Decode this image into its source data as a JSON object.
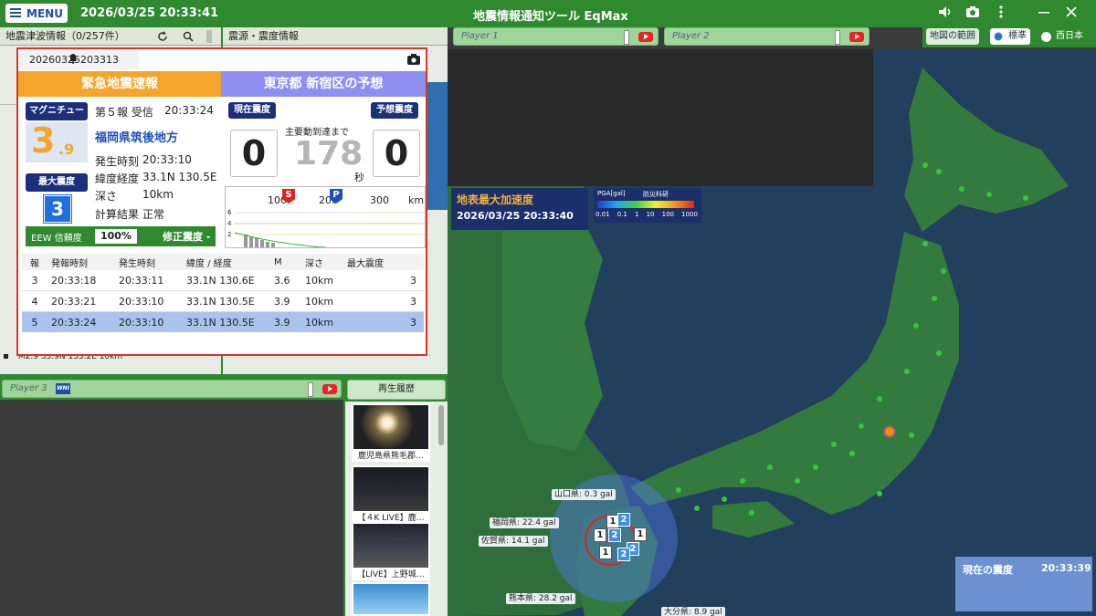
{
  "topbar": {
    "menu_label": "MENU",
    "datetime": "2026/03/25 20:33:41",
    "title": "地震情報通知ツール EqMax"
  },
  "quake_list": {
    "title": "地震津波情報（0/257件）",
    "last_item": "M2.9  33.9N 135.2E  10km"
  },
  "source_panel": {
    "title": "震源・震度情報"
  },
  "players": {
    "p1": "Player 1",
    "p2": "Player 2",
    "p3": "Player 3"
  },
  "map_controls": {
    "range_label": "地図の範囲",
    "option_standard": "標準",
    "option_west": "西日本"
  },
  "eew": {
    "id": "20260325203313",
    "left_title": "緊急地震速報",
    "right_title": "東京都 新宿区の予想",
    "report_line": "第５報 受信",
    "received_time": "20:33:24",
    "magnitude_label": "マグニチュード",
    "magnitude_int": "3",
    "magnitude_dec": ".9",
    "region": "福岡県筑後地方",
    "origin_time_label": "発生時刻",
    "origin_time": "20:33:10",
    "latlon_label": "緯度経度",
    "latlon": "33.1N 130.5E",
    "depth_label": "深さ",
    "depth": "10km",
    "calc_label": "計算結果",
    "calc": "正常",
    "max_int_label": "最大震度",
    "max_int": "3",
    "reliability_label": "EEW 信頼度",
    "reliability": "100%",
    "revised_label": "修正震度 -",
    "current_int_label": "現在震度",
    "current_int": "0",
    "forecast_int_label": "予想震度",
    "forecast_int": "0",
    "countdown_label": "主要動到達まで",
    "countdown": "178",
    "seconds_label": "秒",
    "graph_ticks": [
      "100",
      "200",
      "300",
      "km"
    ],
    "graph_y": [
      "6",
      "4",
      "2"
    ],
    "table_headers": [
      "報",
      "発報時刻",
      "発生時刻",
      "緯度 / 経度",
      "M",
      "深さ",
      "最大震度"
    ],
    "table_rows": [
      [
        "3",
        "20:33:18",
        "20:33:11",
        "33.1N 130.6E",
        "3.6",
        "10km",
        "3"
      ],
      [
        "4",
        "20:33:21",
        "20:33:10",
        "33.1N 130.5E",
        "3.9",
        "10km",
        "3"
      ],
      [
        "5",
        "20:33:24",
        "20:33:10",
        "33.1N 130.5E",
        "3.9",
        "10km",
        "3"
      ]
    ]
  },
  "pga": {
    "title": "地表最大加速度",
    "datetime": "2026/03/25 20:33:40",
    "legend_title": "PGA[gal]",
    "org": "防災科研",
    "scale": [
      "0.01",
      "0.1",
      "1",
      "10",
      "100",
      "1000"
    ]
  },
  "gal_labels": [
    "山口県: 0.3 gal",
    "福岡県: 22.4 gal",
    "佐賀県: 14.1 gal",
    "熊本県: 28.2 gal",
    "大分県: 8.9 gal"
  ],
  "current_intensity": {
    "title": "現在の震度",
    "time": "20:33:39"
  },
  "history": {
    "title": "再生履歴",
    "items": [
      "鹿児島県熊毛郡…",
      "【４K LIVE】鹿…",
      "【LIVE】上野城…"
    ]
  },
  "colors": {
    "topbar": "#2f8a2f",
    "eew_left": "#f4a52a",
    "eew_right": "#8f8ff2",
    "navy": "#1b2f7a"
  }
}
